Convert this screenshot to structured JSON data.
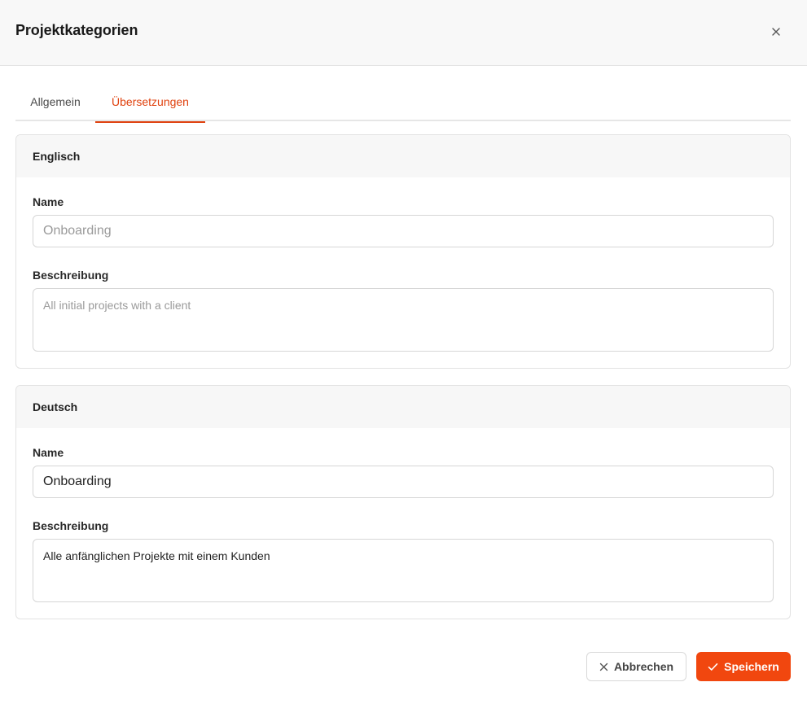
{
  "dialog": {
    "title": "Projektkategorien",
    "close_icon": "close-icon"
  },
  "tabs": [
    {
      "label": "Allgemein",
      "active": false
    },
    {
      "label": "Übersetzungen",
      "active": true
    }
  ],
  "translations": [
    {
      "language": "Englisch",
      "name_label": "Name",
      "name_value": "",
      "name_placeholder": "Onboarding",
      "description_label": "Beschreibung",
      "description_value": "",
      "description_placeholder": "All initial projects with a client"
    },
    {
      "language": "Deutsch",
      "name_label": "Name",
      "name_value": "Onboarding",
      "name_placeholder": "",
      "description_label": "Beschreibung",
      "description_value": "Alle anfänglichen Projekte mit einem Kunden",
      "description_placeholder": ""
    }
  ],
  "footer": {
    "cancel_label": "Abbrechen",
    "cancel_icon": "x-icon",
    "save_label": "Speichern",
    "save_icon": "check-icon"
  },
  "colors": {
    "accent": "#e0420f",
    "primary_button": "#f1470f",
    "header_background": "#f8f8f8",
    "border": "#e2e2e2"
  }
}
